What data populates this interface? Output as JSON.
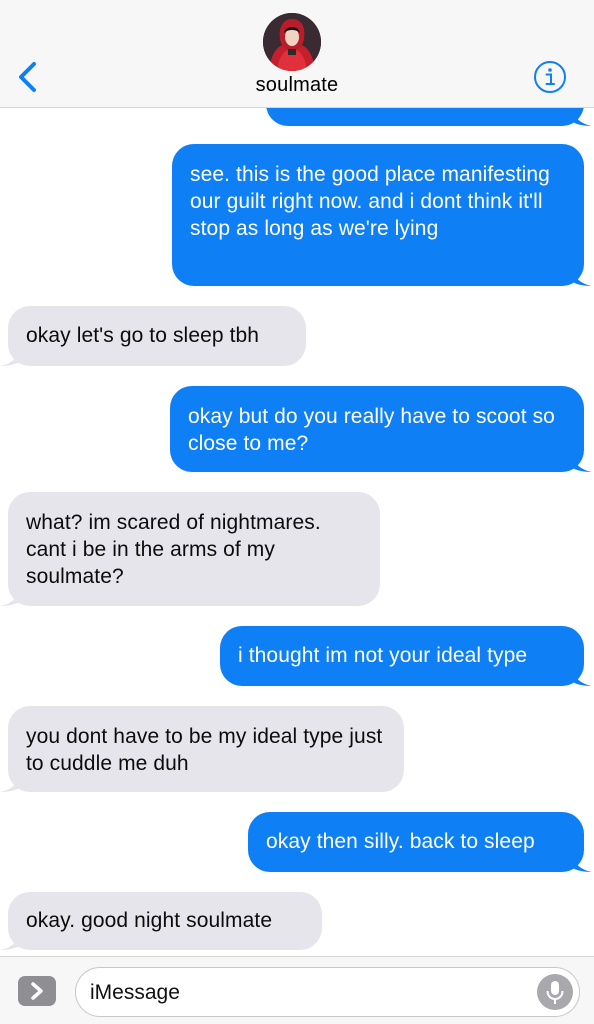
{
  "header": {
    "contact_name": "soulmate",
    "back_icon": "chevron-left-icon",
    "info_icon": "info-icon"
  },
  "messages": [
    {
      "direction": "out",
      "text": ""
    },
    {
      "direction": "out",
      "text": "see. this is the good place manifesting our guilt right now. and i dont think it'll stop as long as we're lying"
    },
    {
      "direction": "in",
      "text": "okay let's go to sleep tbh"
    },
    {
      "direction": "out",
      "text": "okay but do you really have to scoot so close to me?"
    },
    {
      "direction": "in",
      "text": "what? im scared of nightmares. cant i be in the arms of my soulmate?"
    },
    {
      "direction": "out",
      "text": "i thought im not your ideal type"
    },
    {
      "direction": "in",
      "text": "you dont have to be my ideal type just to cuddle me duh"
    },
    {
      "direction": "out",
      "text": "okay then silly. back to sleep"
    },
    {
      "direction": "in",
      "text": "okay. good night soulmate"
    }
  ],
  "input": {
    "placeholder": "iMessage",
    "apps_icon": "chevron-right-icon",
    "mic_icon": "microphone-icon"
  },
  "colors": {
    "outgoing": "#0f7ff6",
    "incoming": "#e6e5eb",
    "accent": "#0f7ff6"
  }
}
